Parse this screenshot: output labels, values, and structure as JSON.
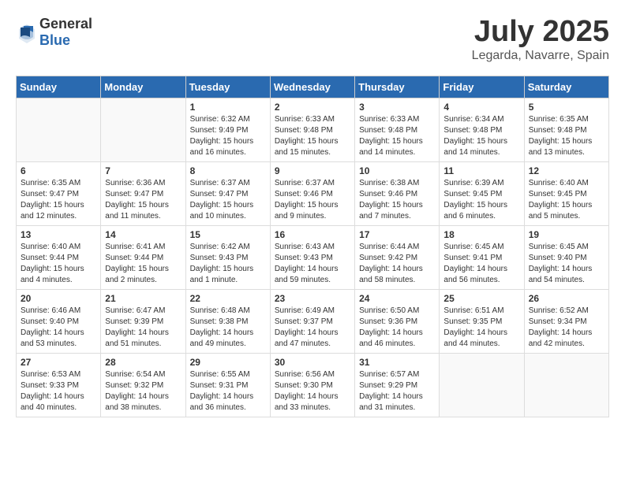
{
  "header": {
    "logo_general": "General",
    "logo_blue": "Blue",
    "month_year": "July 2025",
    "location": "Legarda, Navarre, Spain"
  },
  "weekdays": [
    "Sunday",
    "Monday",
    "Tuesday",
    "Wednesday",
    "Thursday",
    "Friday",
    "Saturday"
  ],
  "weeks": [
    [
      {
        "day": "",
        "info": ""
      },
      {
        "day": "",
        "info": ""
      },
      {
        "day": "1",
        "info": "Sunrise: 6:32 AM\nSunset: 9:49 PM\nDaylight: 15 hours and 16 minutes."
      },
      {
        "day": "2",
        "info": "Sunrise: 6:33 AM\nSunset: 9:48 PM\nDaylight: 15 hours and 15 minutes."
      },
      {
        "day": "3",
        "info": "Sunrise: 6:33 AM\nSunset: 9:48 PM\nDaylight: 15 hours and 14 minutes."
      },
      {
        "day": "4",
        "info": "Sunrise: 6:34 AM\nSunset: 9:48 PM\nDaylight: 15 hours and 14 minutes."
      },
      {
        "day": "5",
        "info": "Sunrise: 6:35 AM\nSunset: 9:48 PM\nDaylight: 15 hours and 13 minutes."
      }
    ],
    [
      {
        "day": "6",
        "info": "Sunrise: 6:35 AM\nSunset: 9:47 PM\nDaylight: 15 hours and 12 minutes."
      },
      {
        "day": "7",
        "info": "Sunrise: 6:36 AM\nSunset: 9:47 PM\nDaylight: 15 hours and 11 minutes."
      },
      {
        "day": "8",
        "info": "Sunrise: 6:37 AM\nSunset: 9:47 PM\nDaylight: 15 hours and 10 minutes."
      },
      {
        "day": "9",
        "info": "Sunrise: 6:37 AM\nSunset: 9:46 PM\nDaylight: 15 hours and 9 minutes."
      },
      {
        "day": "10",
        "info": "Sunrise: 6:38 AM\nSunset: 9:46 PM\nDaylight: 15 hours and 7 minutes."
      },
      {
        "day": "11",
        "info": "Sunrise: 6:39 AM\nSunset: 9:45 PM\nDaylight: 15 hours and 6 minutes."
      },
      {
        "day": "12",
        "info": "Sunrise: 6:40 AM\nSunset: 9:45 PM\nDaylight: 15 hours and 5 minutes."
      }
    ],
    [
      {
        "day": "13",
        "info": "Sunrise: 6:40 AM\nSunset: 9:44 PM\nDaylight: 15 hours and 4 minutes."
      },
      {
        "day": "14",
        "info": "Sunrise: 6:41 AM\nSunset: 9:44 PM\nDaylight: 15 hours and 2 minutes."
      },
      {
        "day": "15",
        "info": "Sunrise: 6:42 AM\nSunset: 9:43 PM\nDaylight: 15 hours and 1 minute."
      },
      {
        "day": "16",
        "info": "Sunrise: 6:43 AM\nSunset: 9:43 PM\nDaylight: 14 hours and 59 minutes."
      },
      {
        "day": "17",
        "info": "Sunrise: 6:44 AM\nSunset: 9:42 PM\nDaylight: 14 hours and 58 minutes."
      },
      {
        "day": "18",
        "info": "Sunrise: 6:45 AM\nSunset: 9:41 PM\nDaylight: 14 hours and 56 minutes."
      },
      {
        "day": "19",
        "info": "Sunrise: 6:45 AM\nSunset: 9:40 PM\nDaylight: 14 hours and 54 minutes."
      }
    ],
    [
      {
        "day": "20",
        "info": "Sunrise: 6:46 AM\nSunset: 9:40 PM\nDaylight: 14 hours and 53 minutes."
      },
      {
        "day": "21",
        "info": "Sunrise: 6:47 AM\nSunset: 9:39 PM\nDaylight: 14 hours and 51 minutes."
      },
      {
        "day": "22",
        "info": "Sunrise: 6:48 AM\nSunset: 9:38 PM\nDaylight: 14 hours and 49 minutes."
      },
      {
        "day": "23",
        "info": "Sunrise: 6:49 AM\nSunset: 9:37 PM\nDaylight: 14 hours and 47 minutes."
      },
      {
        "day": "24",
        "info": "Sunrise: 6:50 AM\nSunset: 9:36 PM\nDaylight: 14 hours and 46 minutes."
      },
      {
        "day": "25",
        "info": "Sunrise: 6:51 AM\nSunset: 9:35 PM\nDaylight: 14 hours and 44 minutes."
      },
      {
        "day": "26",
        "info": "Sunrise: 6:52 AM\nSunset: 9:34 PM\nDaylight: 14 hours and 42 minutes."
      }
    ],
    [
      {
        "day": "27",
        "info": "Sunrise: 6:53 AM\nSunset: 9:33 PM\nDaylight: 14 hours and 40 minutes."
      },
      {
        "day": "28",
        "info": "Sunrise: 6:54 AM\nSunset: 9:32 PM\nDaylight: 14 hours and 38 minutes."
      },
      {
        "day": "29",
        "info": "Sunrise: 6:55 AM\nSunset: 9:31 PM\nDaylight: 14 hours and 36 minutes."
      },
      {
        "day": "30",
        "info": "Sunrise: 6:56 AM\nSunset: 9:30 PM\nDaylight: 14 hours and 33 minutes."
      },
      {
        "day": "31",
        "info": "Sunrise: 6:57 AM\nSunset: 9:29 PM\nDaylight: 14 hours and 31 minutes."
      },
      {
        "day": "",
        "info": ""
      },
      {
        "day": "",
        "info": ""
      }
    ]
  ]
}
